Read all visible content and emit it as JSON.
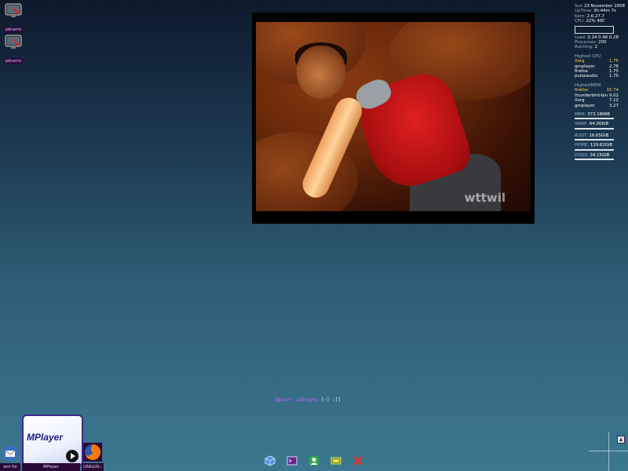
{
  "desktop_icons": [
    {
      "label": "pbharris"
    },
    {
      "label": "pbharris"
    }
  ],
  "video": {
    "watermark": "wttwil"
  },
  "conky": {
    "date_label": "Sun",
    "date_value": "23 November 2008",
    "uptime_label": "UpTime",
    "uptime_value": "3h:44m 7s",
    "kern_label": "Kern",
    "kern_value": "2.6.27.7",
    "cpu_label": "CPU",
    "cpu_value": "22% 40C",
    "load_label": "Load",
    "load_value": "0.24 0.46 0.28",
    "processes_label": "Processes",
    "processes_value": "200",
    "running_label": "Running",
    "running_value": "2",
    "highest_cpu_title": "Highest CPU",
    "highest_cpu": [
      {
        "name": "Xorg",
        "value": "1.75"
      },
      {
        "name": "gmplayer",
        "value": "2.76"
      },
      {
        "name": "firefox",
        "value": "1.75"
      },
      {
        "name": "pulseaudio",
        "value": "1.75"
      }
    ],
    "highest_mem_title": "HighestMEM",
    "highest_mem": [
      {
        "name": "firefox",
        "value": "15.74"
      },
      {
        "name": "thunderbird-bin",
        "value": "9.02"
      },
      {
        "name": "Xorg",
        "value": "7.12"
      },
      {
        "name": "gmplayer",
        "value": "3.27"
      }
    ],
    "mem_label": "MEM",
    "mem_value": "373.18MiB",
    "swap_label": "SWAP",
    "swap_value": "64.00KiB",
    "root_label": "ROOT",
    "root_value": "16.65GiB",
    "home_label": "HOME",
    "home_value": "129.62GiB",
    "dogs_label": "DOGS",
    "dogs_value": "34.15GiB"
  },
  "terminal": {
    "user": "@pcurr ixBraye",
    "rest": ": [~] :[]"
  },
  "mplayer": {
    "title": "MPlayer"
  },
  "taskbar": [
    {
      "label": "ann for"
    },
    {
      "label": "MPlayer"
    },
    {
      "label": "USALUG::"
    }
  ]
}
